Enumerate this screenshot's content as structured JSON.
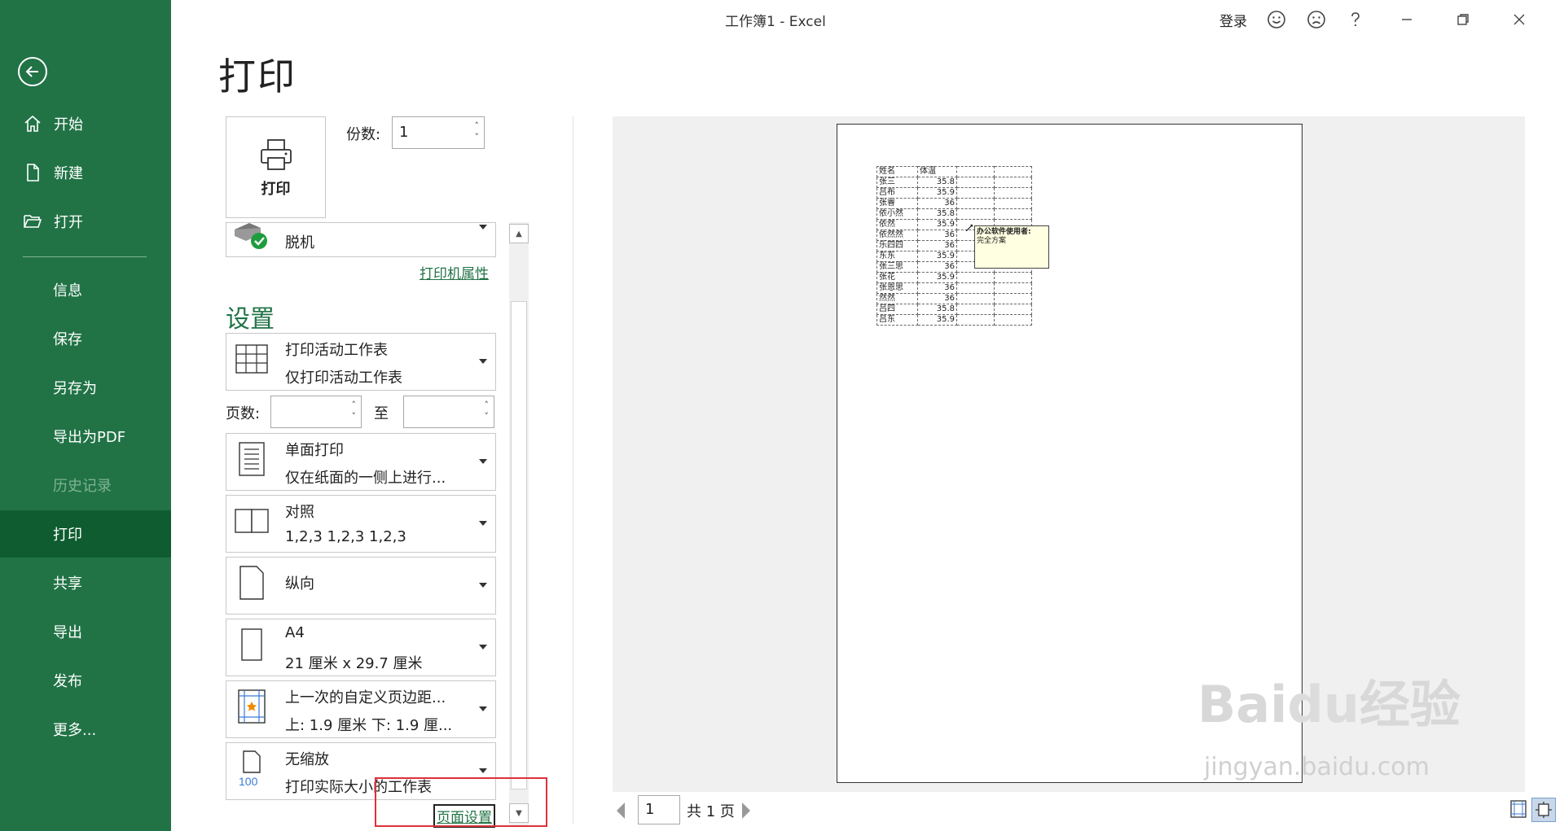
{
  "window": {
    "title": "工作簿1  -  Excel",
    "login": "登录"
  },
  "sidebar": {
    "items": [
      {
        "label": "开始",
        "icon": "home-icon"
      },
      {
        "label": "新建",
        "icon": "new-doc-icon"
      },
      {
        "label": "打开",
        "icon": "open-folder-icon"
      },
      {
        "label": "信息"
      },
      {
        "label": "保存"
      },
      {
        "label": "另存为"
      },
      {
        "label": "导出为PDF"
      },
      {
        "label": "历史记录"
      },
      {
        "label": "打印"
      },
      {
        "label": "共享"
      },
      {
        "label": "导出"
      },
      {
        "label": "发布"
      },
      {
        "label": "更多..."
      }
    ]
  },
  "main": {
    "title": "打印",
    "print_button": "打印",
    "copies_label": "份数:",
    "copies_value": "1",
    "printer": {
      "name": "脱机",
      "properties_link": "打印机属性"
    },
    "settings_heading": "设置",
    "settings": [
      {
        "title": "打印活动工作表",
        "subtitle": "仅打印活动工作表"
      },
      {
        "title": "单面打印",
        "subtitle": "仅在纸面的一侧上进行..."
      },
      {
        "title": "对照",
        "subtitle": "1,2,3    1,2,3    1,2,3"
      },
      {
        "title": "纵向",
        "subtitle": ""
      },
      {
        "title": "A4",
        "subtitle": "21 厘米 x 29.7 厘米"
      },
      {
        "title": "上一次的自定义页边距...",
        "subtitle": "上: 1.9 厘米 下: 1.9 厘..."
      },
      {
        "title": "无缩放",
        "subtitle": "打印实际大小的工作表"
      }
    ],
    "pages_label": "页数:",
    "pages_to": "至",
    "page_setup_link": "页面设置",
    "page_current": "1",
    "page_total": "共 1 页"
  },
  "preview": {
    "headers": [
      "姓名",
      "体温"
    ],
    "rows": [
      [
        "张三",
        "35.8"
      ],
      [
        "吕布",
        "35.9"
      ],
      [
        "张睿",
        "36"
      ],
      [
        "依小然",
        "35.8"
      ],
      [
        "依然",
        "35.9"
      ],
      [
        "依然然",
        "36"
      ],
      [
        "乐四四",
        "36"
      ],
      [
        "东东",
        "35.9"
      ],
      [
        "张三思",
        "36"
      ],
      [
        "张花",
        "35.9"
      ],
      [
        "张恩思",
        "36"
      ],
      [
        "然然",
        "36"
      ],
      [
        "吕四",
        "35.8"
      ],
      [
        "吕东",
        "35.9"
      ]
    ],
    "comment_title": "办公软件使用者:",
    "comment_body": "完全方案"
  },
  "watermark": {
    "logo": "Baidu经验",
    "url": "jingyan.baidu.com"
  },
  "colors": {
    "sidebar": "#217346",
    "sidebar_active": "#0e5c2f",
    "accent": "#217346",
    "highlight_box": "#e0303a"
  }
}
